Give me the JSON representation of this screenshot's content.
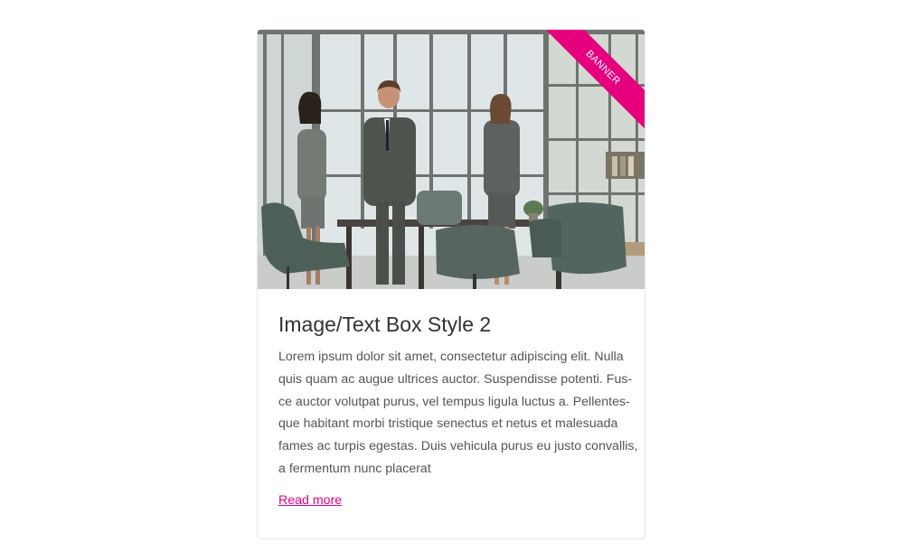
{
  "card": {
    "banner_label": "BANNER",
    "title": "Image/Text Box Style 2",
    "body_lines": [
      "Lorem ipsum dolor sit amet, consectetur adipiscing elit. Nulla",
      "quis quam ac augue ultrices auctor. Suspendisse potenti. Fus-",
      "ce auctor volutpat purus, vel tempus ligula luctus a. Pellentes-",
      "que habitant morbi tristique senectus et netus et malesuada",
      "fames ac turpis egestas. Duis vehicula purus eu justo convallis,",
      "a fermentum nunc placerat"
    ],
    "link_label": "Read more",
    "image_icon": "office-meeting-photo"
  },
  "colors": {
    "accent": "#e6007e",
    "title": "#333333",
    "body_text": "#555555",
    "border": "#e6e6e6"
  }
}
